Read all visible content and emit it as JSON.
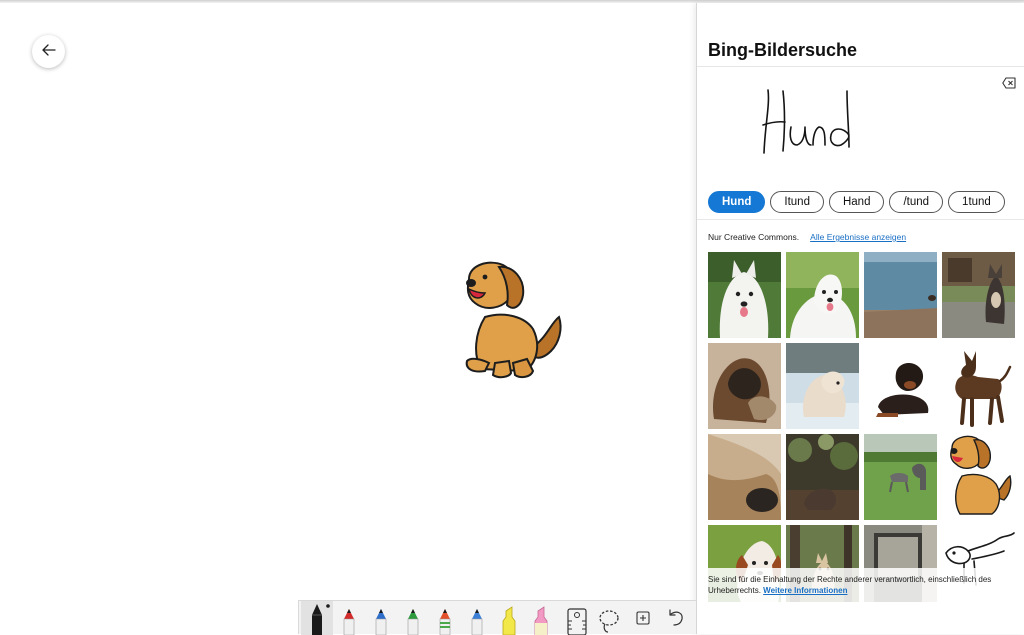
{
  "panel": {
    "title": "Bing-Bildersuche",
    "ink_text": "Hund"
  },
  "suggestions": [
    "Hund",
    "Itund",
    "Hand",
    "/tund",
    "1tund"
  ],
  "filter": {
    "label": "Nur Creative Commons.",
    "link": "Alle Ergebnisse anzeigen"
  },
  "results": [
    "samoyed-portrait",
    "samoyed-on-grass",
    "dog-at-beach",
    "dog-in-garden",
    "dogs-playing",
    "puppy-in-snow",
    "rottweiler-lying",
    "pinscher-standing",
    "dog-closeup",
    "dog-in-forest",
    "dogs-on-lawn",
    "dog-cartoon",
    "spaniel",
    "dog-in-woods",
    "dog-in-doorway",
    "dog-drawing"
  ],
  "notice": {
    "text": "Sie sind für die Einhaltung der Rechte anderer verantwortlich, einschließlich des Urheberrechts.",
    "link": "Weitere Informationen"
  },
  "toolbar": {
    "pens": [
      {
        "name": "black",
        "color": "#1a1a1a"
      },
      {
        "name": "red",
        "color": "#d22b2b"
      },
      {
        "name": "blue",
        "color": "#2f6fc9"
      },
      {
        "name": "green",
        "color": "#2e9a3e"
      },
      {
        "name": "rainbow",
        "color": "#e3502c"
      },
      {
        "name": "galaxy",
        "color": "#3c7fd6"
      }
    ],
    "highlighters": [
      {
        "name": "yellow",
        "color": "#f3e84a"
      },
      {
        "name": "pink",
        "color": "#f29ac4"
      }
    ],
    "icons": [
      "ruler-icon",
      "lasso-icon",
      "add-page-icon",
      "undo-icon"
    ]
  },
  "colors": {
    "accent": "#1478d4",
    "link": "#1a6fc4"
  }
}
